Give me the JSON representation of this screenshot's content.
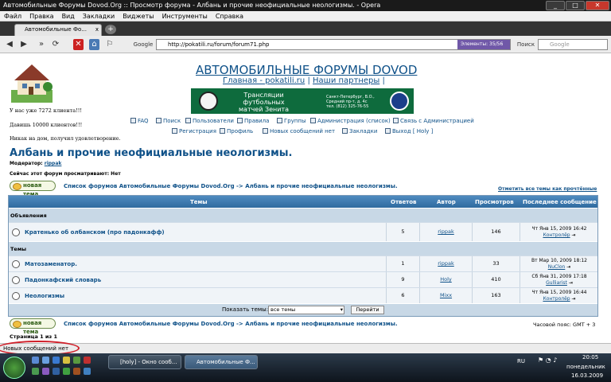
{
  "window": {
    "title": "Автомобильные Форумы Dovod.Org :: Просмотр форума - Албань и прочие неофициальные неологизмы. - Opera",
    "minimize": "_",
    "maximize": "□",
    "close": "✕"
  },
  "menu": [
    "Файл",
    "Правка",
    "Вид",
    "Закладки",
    "Виджеты",
    "Инструменты",
    "Справка"
  ],
  "tab": {
    "label": "Автомобильные Фо...",
    "close": "x",
    "new_tab": "+"
  },
  "nav": {
    "address": "http://pokatili.ru/forum/forum71.php",
    "engine_label": "Google",
    "elements_badge": "Элементы: 35/56",
    "search_label": "Поиск",
    "search_placeholder": "Google"
  },
  "side": {
    "visitors": "У нас уже 7272 клиента!!!",
    "day": "Давишь 10000 клиентов!!!",
    "note": "Никак на дом, получил удовлетворение."
  },
  "header": {
    "site_title": "АВТОМОБИЛЬНЫЕ ФОРУМЫ DOVOD",
    "home_link": "Главная - pokatili.ru",
    "partners_link": "Наши партнеры",
    "sep1": "|",
    "sep2": "|"
  },
  "banner": {
    "line1": "Трансляции",
    "line2": "футбольных",
    "line3": "матчей Зенита",
    "addr1": "Санкт-Петербург, В.О.,",
    "addr2": "Средний пр-т, д. 4с",
    "phone": "тел. (812) 325-76-55"
  },
  "menu_links": {
    "faq": "FAQ",
    "search": "Поиск",
    "members": "Пользователи",
    "rules": "Правила",
    "groups": "Группы",
    "admin": "Администрация (список)",
    "contact": "Связь с Администрацией",
    "register": "Регистрация",
    "profile": "Профиль",
    "new_posts": "Новых сообщений нет",
    "bookmarks": "Закладки",
    "logout": "Выход [ Holy ]"
  },
  "forum": {
    "title": "Албань и прочие неофициальные неологизмы.",
    "moderator_label": "Модератор:",
    "moderator": "rippak",
    "viewing": "Сейчас этот форум просматривают: Нет",
    "new_topic": "новая тема",
    "breadcrumb": "Список форумов Автомобильные Форумы Dovod.Org -> Албань и прочие неофициальные неологизмы.",
    "mark_read": "Отметить все темы как прочтённые",
    "timezone": "Часовой пояс: GMT + 3",
    "pages": "Страница 1 из 1"
  },
  "table": {
    "headers": [
      "Темы",
      "Ответов",
      "Автор",
      "Просмотров",
      "Последнее сообщение"
    ],
    "announcements_label": "Объявления",
    "topics_label": "Темы",
    "announcements": [
      {
        "title": "Кратенько об олбанском (про падонкафф)",
        "replies": "5",
        "author": "rippak",
        "views": "146",
        "last_date": "Чт Янв 15, 2009 16:42",
        "last_user": "Контролёр"
      }
    ],
    "topics": [
      {
        "title": "Матозаменатор.",
        "replies": "1",
        "author": "rippak",
        "views": "33",
        "last_date": "Вт Мар 10, 2009 18:12",
        "last_user": "NuClon"
      },
      {
        "title": "Падонкафский словарь",
        "replies": "9",
        "author": "Holy",
        "views": "410",
        "last_date": "Сб Янв 31, 2009 17:18",
        "last_user": "Gulliarist"
      },
      {
        "title": "Неологизмы",
        "replies": "6",
        "author": "Mixx",
        "views": "163",
        "last_date": "Чт Янв 15, 2009 16:44",
        "last_user": "Контролёр"
      }
    ],
    "show_label": "Показать темы:",
    "show_value": "все темы",
    "go_button": "Перейти"
  },
  "statusbar": {
    "text": "Новых сообщений нет"
  },
  "taskbar": {
    "items": [
      "[holy] - Окно сооб...",
      "Автомобильные Ф..."
    ],
    "lang": "RU",
    "time": "20:05",
    "day": "понедельник",
    "date": "16.03.2009"
  },
  "colors": {
    "link": "#105289",
    "table_header": "#3f7ab0",
    "category": "#c8d8e6",
    "highlight": "#d0202a"
  }
}
